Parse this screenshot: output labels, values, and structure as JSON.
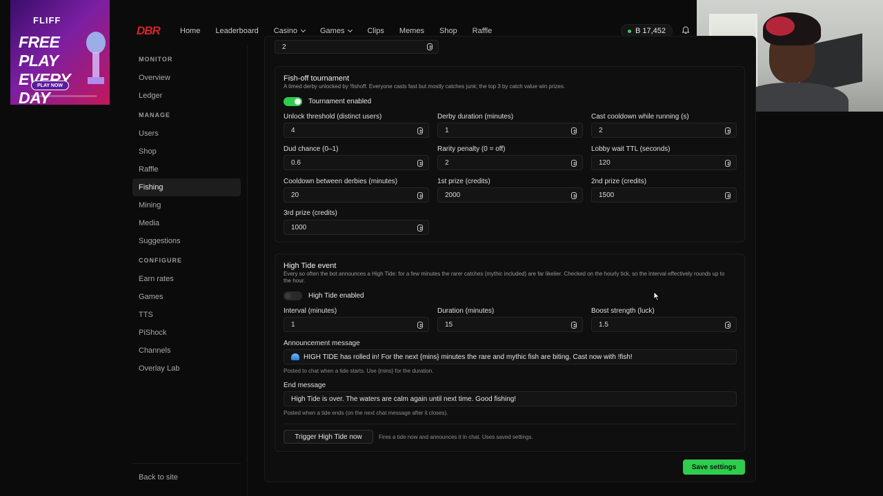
{
  "ad": {
    "brand": "FLIFF",
    "headline": "FREE PLAY EVERY DAY",
    "cta": "PLAY NOW"
  },
  "header": {
    "logo": "DBR",
    "nav": [
      {
        "label": "Home"
      },
      {
        "label": "Leaderboard"
      },
      {
        "label": "Casino",
        "dropdown": true
      },
      {
        "label": "Games",
        "dropdown": true
      },
      {
        "label": "Clips"
      },
      {
        "label": "Memes"
      },
      {
        "label": "Shop"
      },
      {
        "label": "Raffle"
      }
    ],
    "balance": "B 17,452",
    "balance_dot_color": "#3ecf5a"
  },
  "sidebar": {
    "sections": [
      {
        "title": "MONITOR",
        "items": [
          "Overview",
          "Ledger"
        ]
      },
      {
        "title": "MANAGE",
        "items": [
          "Users",
          "Shop",
          "Raffle",
          "Fishing",
          "Mining",
          "Media",
          "Suggestions"
        ]
      },
      {
        "title": "CONFIGURE",
        "items": [
          "Earn rates",
          "Games",
          "TTS",
          "PiShock",
          "Channels",
          "Overlay Lab"
        ]
      }
    ],
    "active": "Fishing",
    "back": "Back to site"
  },
  "top_partial_field": {
    "value": "2"
  },
  "fishoff": {
    "title": "Fish-off tournament",
    "desc": "A timed derby unlocked by !fishoff. Everyone casts fast but mostly catches junk; the top 3 by catch value win prizes.",
    "toggle_label": "Tournament enabled",
    "toggle_on": true,
    "fields": [
      {
        "label": "Unlock threshold (distinct users)",
        "value": "4"
      },
      {
        "label": "Derby duration (minutes)",
        "value": "1"
      },
      {
        "label": "Cast cooldown while running (s)",
        "value": "2"
      },
      {
        "label": "Dud chance (0–1)",
        "value": "0.6"
      },
      {
        "label": "Rarity penalty (0 = off)",
        "value": "2"
      },
      {
        "label": "Lobby wait TTL (seconds)",
        "value": "120"
      },
      {
        "label": "Cooldown between derbies (minutes)",
        "value": "20"
      },
      {
        "label": "1st prize (credits)",
        "value": "2000"
      },
      {
        "label": "2nd prize (credits)",
        "value": "1500"
      },
      {
        "label": "3rd prize (credits)",
        "value": "1000"
      }
    ]
  },
  "hightide": {
    "title": "High Tide event",
    "desc": "Every so often the bot announces a High Tide: for a few minutes the rarer catches (mythic included) are far likelier. Checked on the hourly tick, so the interval effectively rounds up to the hour.",
    "toggle_label": "High Tide enabled",
    "toggle_on": false,
    "fields": [
      {
        "label": "Interval (minutes)",
        "value": "1"
      },
      {
        "label": "Duration (minutes)",
        "value": "15"
      },
      {
        "label": "Boost strength (luck)",
        "value": "1.5"
      }
    ],
    "announcement_label": "Announcement message",
    "announcement_value": "HIGH TIDE has rolled in! For the next {mins} minutes the rare and mythic fish are biting. Cast now with !fish!",
    "announcement_hint": "Posted to chat when a tide starts. Use {mins} for the duration.",
    "end_label": "End message",
    "end_value": "High Tide is over. The waters are calm again until next time. Good fishing!",
    "end_hint": "Posted when a tide ends (on the next chat message after it closes).",
    "trigger_button": "Trigger High Tide now",
    "trigger_hint": "Fires a tide now and announces it in chat. Uses saved settings."
  },
  "save_button": "Save settings",
  "colors": {
    "accent_green": "#2ecc4f",
    "logo_red": "#d4262a"
  }
}
